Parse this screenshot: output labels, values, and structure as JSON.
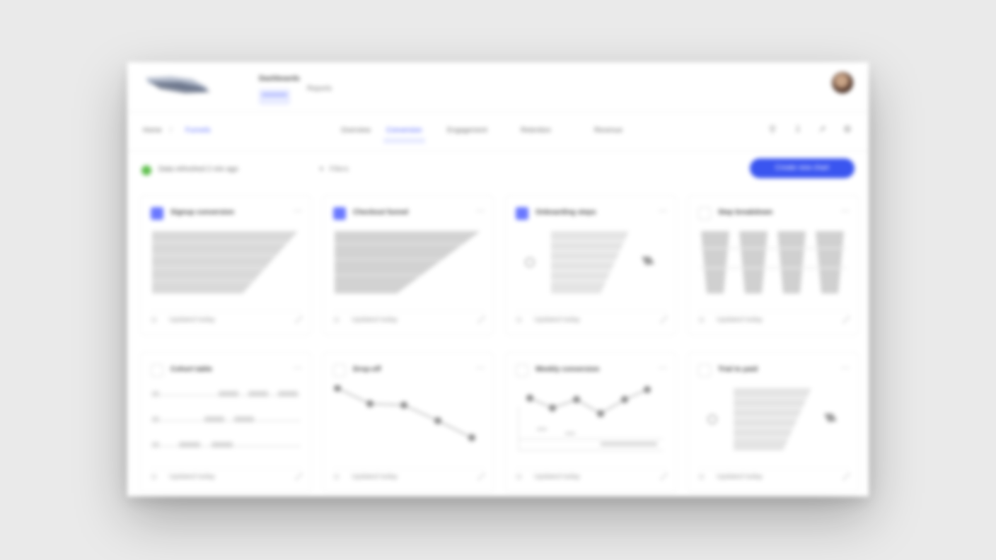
{
  "app": {
    "tabs": [
      {
        "label": "Dashboards",
        "active": true
      },
      {
        "label": "Reports"
      }
    ]
  },
  "breadcrumb": {
    "home": "Home",
    "separator": "/",
    "current": "Funnels"
  },
  "nav_tabs": [
    {
      "label": "Overview",
      "active": false
    },
    {
      "label": "Conversion",
      "active": true
    },
    {
      "label": "Engagement",
      "active": false
    },
    {
      "label": "Retention",
      "active": false
    },
    {
      "label": "Revenue",
      "active": false
    }
  ],
  "toolbar_icons": [
    "filter-icon",
    "download-icon",
    "share-icon",
    "settings-icon"
  ],
  "status": {
    "text": "Data refreshed 2 min ago",
    "color": "#5fbf4d"
  },
  "filter": {
    "label": "Filters"
  },
  "primary_action": {
    "label": "Create new chart",
    "color": "#3a55f0"
  },
  "cards": [
    {
      "title": "Signup conversion",
      "selected": true,
      "kind": "funnel",
      "footer": "Updated today"
    },
    {
      "title": "Checkout funnel",
      "selected": true,
      "kind": "funnel",
      "footer": "Updated today"
    },
    {
      "title": "Onboarding steps",
      "selected": true,
      "kind": "funnel-steps",
      "footer": "Updated today"
    },
    {
      "title": "Step breakdown",
      "selected": false,
      "kind": "columns",
      "footer": "Updated today"
    },
    {
      "title": "Cohort table",
      "selected": false,
      "kind": "table",
      "footer": "Updated today"
    },
    {
      "title": "Drop-off",
      "selected": false,
      "kind": "line-down",
      "footer": "Updated today"
    },
    {
      "title": "Weekly conversion",
      "selected": false,
      "kind": "line-wave",
      "footer": "Updated today"
    },
    {
      "title": "Trial to paid",
      "selected": false,
      "kind": "funnel-steps",
      "footer": "Updated today"
    }
  ],
  "accent": "#4a5cff"
}
